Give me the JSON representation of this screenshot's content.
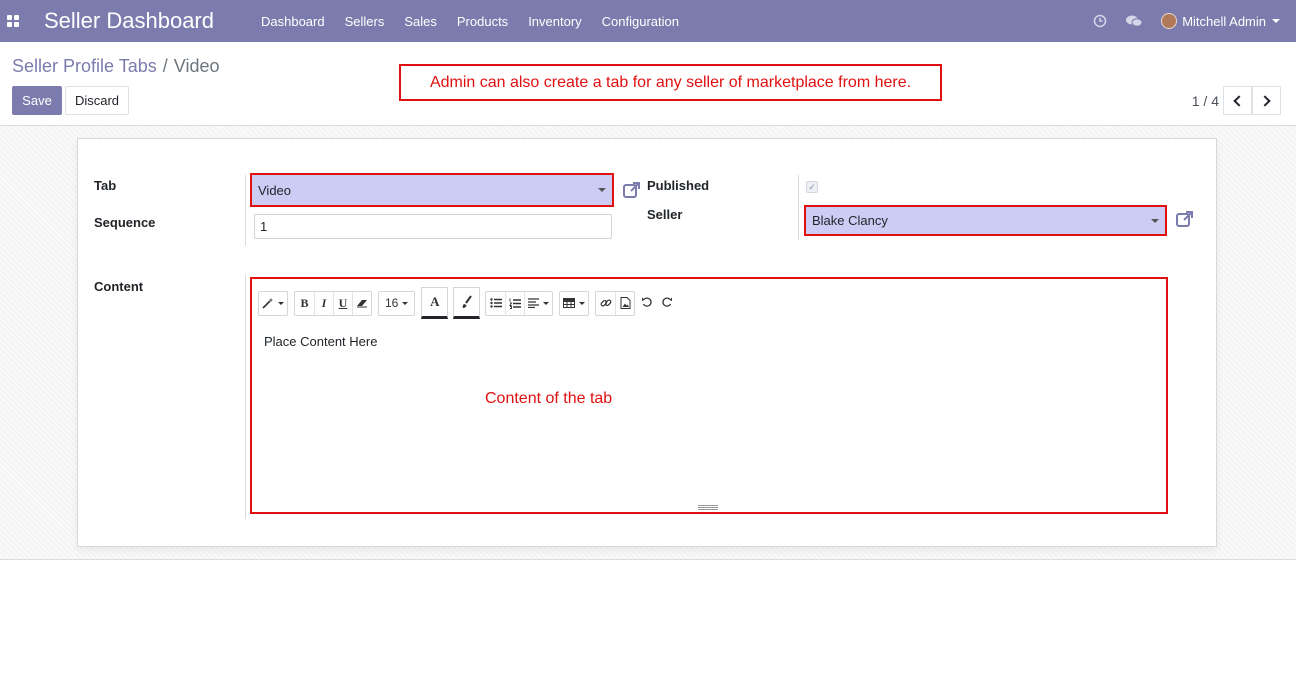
{
  "app": {
    "title": "Seller Dashboard"
  },
  "nav": {
    "menu": [
      "Dashboard",
      "Sellers",
      "Sales",
      "Products",
      "Inventory",
      "Configuration"
    ],
    "user": "Mitchell Admin",
    "icons": [
      "activity-clock-icon",
      "chat-icon"
    ]
  },
  "breadcrumb": {
    "parent": "Seller Profile Tabs",
    "separator": "/",
    "current": "Video"
  },
  "buttons": {
    "save": "Save",
    "discard": "Discard"
  },
  "annotations": {
    "top": "Admin can also create a tab for any seller of marketplace from here.",
    "content": "Content of the tab"
  },
  "pager": {
    "value": "1 / 4"
  },
  "form": {
    "tab_label": "Tab",
    "tab_value": "Video",
    "sequence_label": "Sequence",
    "sequence_value": "1",
    "published_label": "Published",
    "published_checked": true,
    "seller_label": "Seller",
    "seller_value": "Blake Clancy",
    "content_label": "Content",
    "content_value": "Place Content Here"
  },
  "editor": {
    "font_size": "16",
    "text_color_glyph": "A"
  },
  "colors": {
    "navbar": "#7c7bad",
    "primary": "#7c7bad",
    "annotation": "#e01010",
    "highlight": "#ccccf5"
  }
}
